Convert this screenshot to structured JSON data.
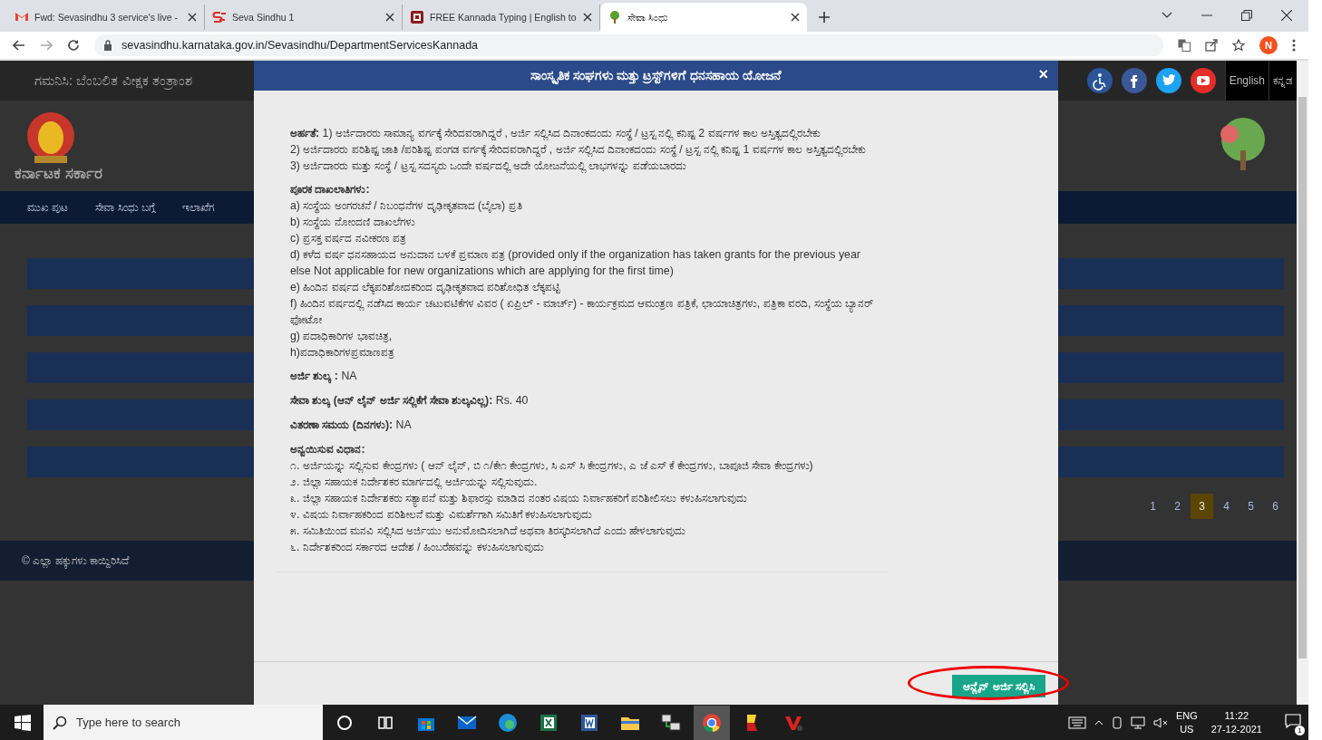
{
  "browser": {
    "tabs": [
      {
        "title": "Fwd: Sevasindhu 3 service's live -",
        "kind": "gmail",
        "selected": false
      },
      {
        "title": "Seva Sindhu 1",
        "kind": "seva",
        "selected": false
      },
      {
        "title": "FREE Kannada Typing | English to",
        "kind": "typing",
        "selected": false
      },
      {
        "title": "ಸೇವಾ ಸಿಂಧು",
        "kind": "tree",
        "selected": true
      }
    ],
    "url": "sevasindhu.karnataka.gov.in/Sevasindhu/DepartmentServicesKannada",
    "profile": "N"
  },
  "page": {
    "notice": "ಗಮನಿಸಿ: ಬೆಂಬಲಿತ ವೀಕ್ಷಕ ತಂತ್ರಾಂಶ",
    "languages": [
      "English",
      "ಕನ್ನಡ"
    ],
    "government": "ಕರ್ನಾಟಕ ಸರ್ಕಾರ",
    "nav": [
      "ಮುಖ ಪುಟ",
      "ಸೇವಾ ಸಿಂಧು ಬಗ್ಗೆ",
      "ಇಲಾಖೆಗ"
    ],
    "pagination": [
      {
        "label": "1",
        "selected": false
      },
      {
        "label": "2",
        "selected": false
      },
      {
        "label": "3",
        "selected": true
      },
      {
        "label": "4",
        "selected": false
      },
      {
        "label": "5",
        "selected": false
      },
      {
        "label": "6",
        "selected": false
      }
    ],
    "footer": "© ಎಲ್ಲಾ ಹಕ್ಕುಗಳು ಕಾಯ್ದಿರಿಸಿದೆ"
  },
  "modal": {
    "title": "ಸಾಂಸ್ಕೃತಿಕ ಸಂಘಗಳು ಮತ್ತು ಟ್ರಸ್ಟ್‌ಗಳಿಗೆ ಧನಸಹಾಯ ಯೋಜನೆ",
    "close": "×",
    "blocks": [
      {
        "kind": "list",
        "items": [
          "**ಅರ್ಹತೆ:** 1) ಅರ್ಜಿದಾರರು ಸಾಮಾನ್ಯ ವರ್ಗಕ್ಕೆ ಸೇರಿದವರಾಗಿದ್ದರೆ , ಅರ್ಜಿ ಸಲ್ಲಿಸಿದ ದಿನಾಂಕದಂದು ಸಂಸ್ಥೆ / ಟ್ರಸ್ಟ ನಲ್ಲಿ ಕನಿಷ್ಟ 2 ವರ್ಷಗಳ ಕಾಲ ಅಸ್ತಿತ್ವದಲ್ಲಿರಬೇಕು",
          "2) ಅರ್ಜಿದಾರರು ಪರಿಶಿಷ್ಟ ಜಾತಿ /ಪರಿಶಿಷ್ಟ ಪಂಗಡ ವರ್ಗಕ್ಕೆ ಸೇರಿದವರಾಗಿದ್ದರೆ , ಅರ್ಜಿ ಸಲ್ಲಿಸಿದ ದಿನಾಂಕದಂದು ಸಂಸ್ಥೆ / ಟ್ರಸ್ಟ ನಲ್ಲಿ ಕನಿಷ್ಟ 1 ವರ್ಷಗಳ ಕಾಲ ಅಸ್ತಿತ್ವದಲ್ಲಿರಬೇಕು",
          "3) ಅರ್ಜಿದಾರರು ಮತ್ತು ಸಂಸ್ಥೆ / ಟ್ರಸ್ಟ ಸದಸ್ಯರು ಒಂದೇ ವರ್ಷದಲ್ಲಿ ಅದೇ ಯೋಜನೆಯಲ್ಲಿ ಲಾಭಗಳನ್ನು ಪಡೆಯಬಾರದು"
        ]
      },
      {
        "kind": "list",
        "heading": "ಪೂರಕ ದಾಖಲಾತಿಗಳು:",
        "items": [
          "a) ಸಂಸ್ಥೆಯ ಅಂಗರಚನೆ / ನಿಬಂಧನೆಗಳ ದೃಢೀಕೃತವಾದ (ಬೈಲಾ) ಪ್ರತಿ",
          "b) ಸಂಸ್ಥೆಯ ನೋಂದಣಿ ದಾಖಲೆಗಳು",
          "c) ಪ್ರಸಕ್ತ ವರ್ಷದ ನವೀಕರಣ ಪತ್ರ",
          "d) ಕಳೆದ ವರ್ಷ ಧನಸಹಾಯದ ಅನುದಾನ ಬಳಕೆ ಪ್ರಮಾಣ ಪತ್ರ (provided only if the organization has taken grants for the previous year else Not applicable for new organizations which are applying for the first time)",
          "e) ಹಿಂದಿನ ವರ್ಷದ ಲೆಕ್ಕಪರಿಶೋದಕರಿಂದ ದೃಢೀಕೃತವಾದ ಪರಿಶೋಧಿತ ಲೆಕ್ಕಪಟ್ಟಿ",
          "f) ಹಿಂದಿನ ವರ್ಷದಲ್ಲಿ ನಡೆಸಿದ ಕಾರ್ಯ ಚಟುವಟಿಕೆಗಳ ವಿವರ ( ಏಪ್ರಿಲ್ - ಮಾರ್ಚ್) - ಕಾರ್ಯಕ್ರಮದ ಆಮಂತ್ರಣ ಪತ್ರಿಕೆ, ಛಾಯಾಚಿತ್ರಗಳು, ಪತ್ರಿಕಾ ವರದಿ, ಸಂಸ್ಥೆಯ ಬ್ಯಾನರ್ ಫೋಟೋ",
          "g) ಪದಾಧಿಕಾರಿಗಳ ಭಾವಚಿತ್ರ,",
          "h)ಪದಾಧಿಕಾರಿಗಳಪ್ರಮಾಣಪತ್ರ"
        ]
      },
      {
        "kind": "field",
        "text": "**ಅರ್ಜಿ ಶುಲ್ಕ :** NA"
      },
      {
        "kind": "field",
        "text": "**ಸೇವಾ ಶುಲ್ಕ (ಆನ್ ಲೈನ್ ಅರ್ಜಿ ಸಲ್ಲಿಕೆಗೆ ಸೇವಾ ಶುಲ್ಕವಿಲ್ಲ):** Rs. 40"
      },
      {
        "kind": "field",
        "text": "**ವಿತರಣಾ ಸಮಯ (ದಿನಗಳು):** NA"
      },
      {
        "kind": "list",
        "heading": "ಅನ್ವಯಿಸುವ ವಿಧಾನ:",
        "items": [
          "೧. ಅರ್ಜಿಯನ್ನು ಸಲ್ಲಿಸುವ ಕೇಂದ್ರಗಳು ( ಆನ್ ಲೈನ್, ಬಿ ೧/ಕೇ೧ ಕೇಂದ್ರಗಳು, ಸಿ ಎಸ್ ಸಿ ಕೇಂದ್ರಗಳು, ಎ ಜೆ ಎಸ್ ಕೆ ಕೇಂದ್ರಗಳು, ಬಾಪೂಜಿ ಸೇವಾ ಕೇಂದ್ರಗಳು)",
          "೨. ಜಿಲ್ಲಾ ಸಹಾಯಕ ನಿರ್ದೇಶಕರ ಮಾರ್ಗದಲ್ಲಿ ಅರ್ಜಿಯನ್ನು ಸಲ್ಲಿಸುವುದು.",
          "೩. ಜಿಲ್ಲಾ ಸಹಾಯಕ ನಿರ್ದೇಶಕರು ಸತ್ಯಾಪನೆ ಮತ್ತು ಶಿಫಾರಸ್ಸು ಮಾಡಿದ ನಂತರ ವಿಷಯ ನಿರ್ವಾಹಕರಿಗೆ ಪರಿಶೀಲಿಸಲು ಕಳುಹಿಸಲಾಗುವುದು",
          "೪. ವಿಷಯ ನಿರ್ವಾಹಕರಿಂದ ಪರಿಶೀಲನೆ ಮತ್ತು ವಿಮರ್ಶೆಗಾಗಿ ಸಮಿತಿಗೆ ಕಳುಹಿಸಲಾಗುವುದು",
          "೫. ಸಮಿತಿಯಿಂದ ಮನವಿ ಸಲ್ಲಿಸಿದ ಅರ್ಜಿಯು ಅನುಮೋದಿಸಲಾಗಿದೆ ಅಥವಾ ತಿರಸ್ಕರಿಸಲಾಗಿದೆ ಎಂದು ಹೇಳಲಾಗುವುದು",
          "೬. ನಿರ್ದೇಶಕರಿಂದ ಸರ್ಕಾರದ ಆದೇಶ / ಹಿಂಬರೆಹವನ್ನು ಕಳುಹಿಸಲಾಗುವುದು"
        ]
      }
    ],
    "apply_button": "ಆನ್ಲೈನ್ ಅರ್ಜಿ ಸಲ್ಲಿಸಿ",
    "apply_button_circled": true
  },
  "taskbar": {
    "search_placeholder": "Type here to search",
    "apps": [
      {
        "kind": "cortana",
        "active": false
      },
      {
        "kind": "taskview",
        "active": false
      },
      {
        "kind": "store",
        "active": false
      },
      {
        "kind": "mail",
        "active": false
      },
      {
        "kind": "edge",
        "active": false
      },
      {
        "kind": "excel",
        "active": false
      },
      {
        "kind": "word",
        "active": false
      },
      {
        "kind": "folder",
        "active": false
      },
      {
        "kind": "network",
        "active": false
      },
      {
        "kind": "chrome",
        "active": true
      },
      {
        "kind": "typing",
        "active": false
      },
      {
        "kind": "vs",
        "active": false
      }
    ],
    "language": "ENG",
    "region": "US",
    "time": "11:22",
    "date": "27-12-2021",
    "notifications": "1"
  }
}
